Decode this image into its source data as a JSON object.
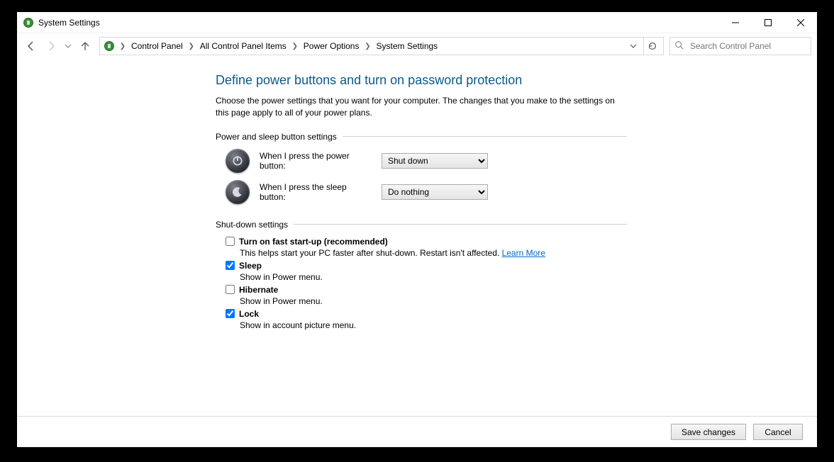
{
  "window": {
    "title": "System Settings"
  },
  "breadcrumbs": {
    "items": [
      "Control Panel",
      "All Control Panel Items",
      "Power Options",
      "System Settings"
    ]
  },
  "search": {
    "placeholder": "Search Control Panel"
  },
  "page": {
    "heading": "Define power buttons and turn on password protection",
    "description": "Choose the power settings that you want for your computer. The changes that you make to the settings on this page apply to all of your power plans.",
    "section_power": "Power and sleep button settings",
    "power_label": "When I press the power button:",
    "power_value": "Shut down",
    "sleep_label": "When I press the sleep button:",
    "sleep_value": "Do nothing",
    "section_shutdown": "Shut-down settings",
    "fast_startup": {
      "label": "Turn on fast start-up (recommended)",
      "desc": "This helps start your PC faster after shut-down. Restart isn't affected. ",
      "link": "Learn More",
      "checked": false
    },
    "sleep_chk": {
      "label": "Sleep",
      "desc": "Show in Power menu.",
      "checked": true
    },
    "hibernate_chk": {
      "label": "Hibernate",
      "desc": "Show in Power menu.",
      "checked": false
    },
    "lock_chk": {
      "label": "Lock",
      "desc": "Show in account picture menu.",
      "checked": true
    }
  },
  "footer": {
    "save": "Save changes",
    "cancel": "Cancel"
  }
}
